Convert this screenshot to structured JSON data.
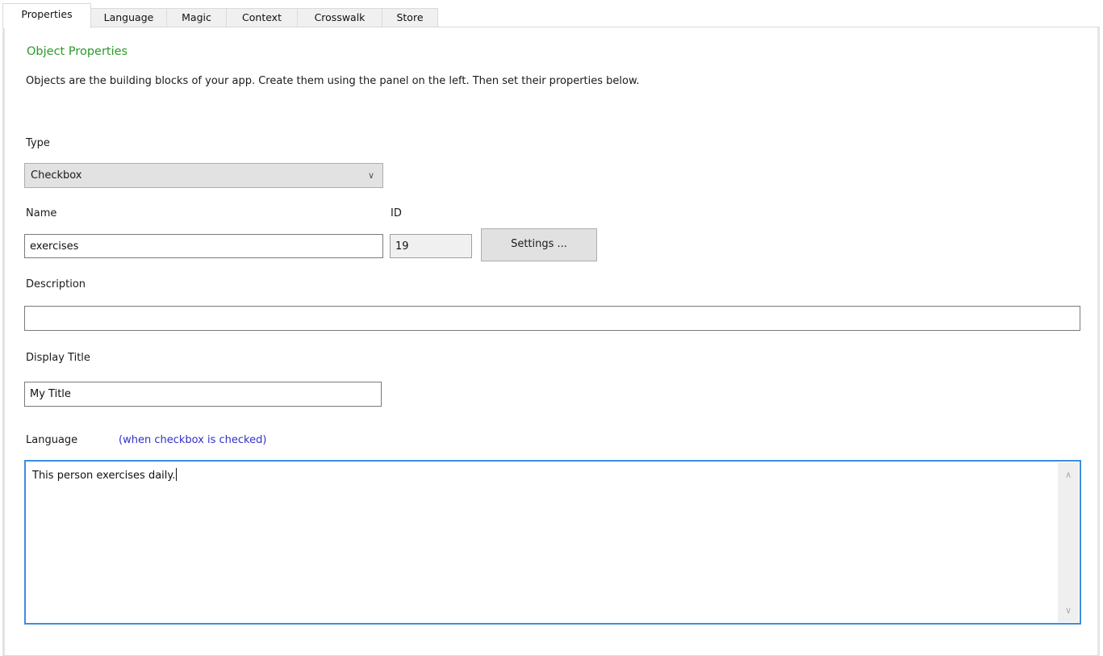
{
  "tabs": [
    {
      "label": "Properties",
      "active": true
    },
    {
      "label": "Language",
      "active": false
    },
    {
      "label": "Magic",
      "active": false
    },
    {
      "label": "Context",
      "active": false
    },
    {
      "label": "Crosswalk",
      "active": false
    },
    {
      "label": "Store",
      "active": false
    }
  ],
  "section": {
    "title": "Object Properties",
    "intro": "Objects are the building blocks of your app. Create them using the panel on the left. Then set their properties below."
  },
  "form": {
    "type_label": "Type",
    "type_value": "Checkbox",
    "name_label": "Name",
    "name_value": "exercises",
    "id_label": "ID",
    "id_value": "19",
    "settings_button": "Settings ...",
    "description_label": "Description",
    "description_value": "",
    "display_title_label": "Display Title",
    "display_title_value": "My Title",
    "language_label": "Language",
    "language_hint": "(when checkbox is checked)",
    "language_value": "This person exercises daily."
  },
  "icons": {
    "dropdown": "chevron-down-icon",
    "scroll_up": "chevron-up-icon",
    "scroll_down": "chevron-down-icon"
  },
  "colors": {
    "title": "#2a9a2a",
    "hint": "#3030c8",
    "focus_border": "#3d8ee0"
  }
}
